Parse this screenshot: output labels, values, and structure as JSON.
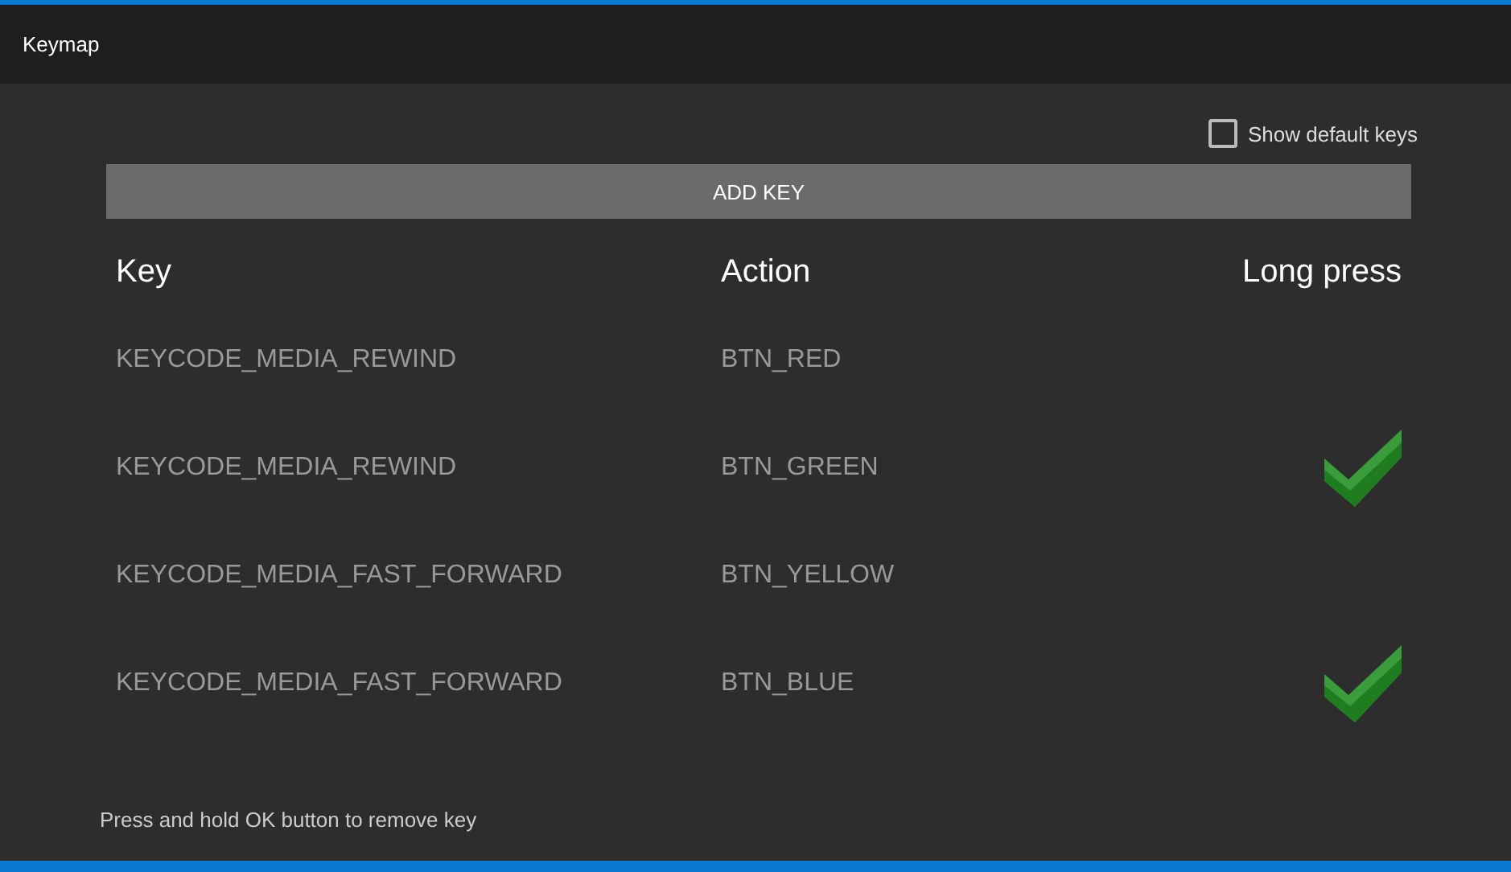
{
  "window": {
    "title": "Keymap"
  },
  "show_default_keys": {
    "label": "Show default keys",
    "checked": false
  },
  "add_button": {
    "label": "ADD KEY"
  },
  "table": {
    "columns": [
      "Key",
      "Action",
      "Long press"
    ],
    "rows": [
      {
        "key": "KEYCODE_MEDIA_REWIND",
        "action": "BTN_RED",
        "long_press": false
      },
      {
        "key": "KEYCODE_MEDIA_REWIND",
        "action": "BTN_GREEN",
        "long_press": true
      },
      {
        "key": "KEYCODE_MEDIA_FAST_FORWARD",
        "action": "BTN_YELLOW",
        "long_press": false
      },
      {
        "key": "KEYCODE_MEDIA_FAST_FORWARD",
        "action": "BTN_BLUE",
        "long_press": true
      }
    ]
  },
  "hint": "Press and hold OK button to remove key"
}
